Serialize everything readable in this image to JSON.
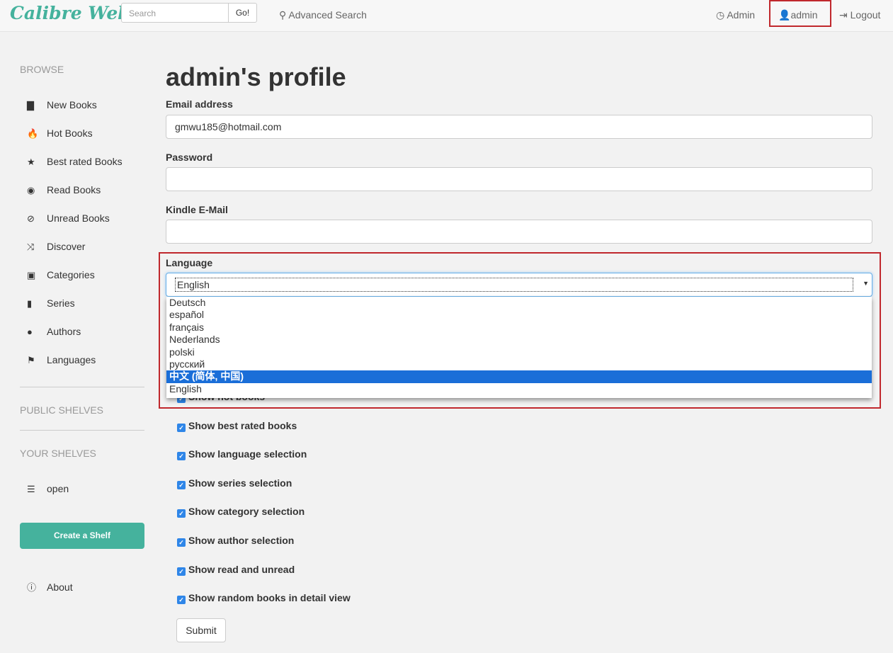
{
  "nav": {
    "logo": "Calibre Web",
    "search_placeholder": "Search",
    "go": "Go!",
    "advanced_search": "Advanced Search",
    "admin": "Admin",
    "user": "admin",
    "logout": "Logout"
  },
  "sidebar": {
    "browse": "BROWSE",
    "items": [
      {
        "icon": "book-icon",
        "glyph": "▇",
        "label": "New Books"
      },
      {
        "icon": "fire-icon",
        "glyph": "🔥",
        "label": "Hot Books"
      },
      {
        "icon": "star-icon",
        "glyph": "★",
        "label": "Best rated Books"
      },
      {
        "icon": "eye-icon",
        "glyph": "◉",
        "label": "Read Books"
      },
      {
        "icon": "eye-slash-icon",
        "glyph": "⊘",
        "label": "Unread Books"
      },
      {
        "icon": "random-icon",
        "glyph": "⤨",
        "label": "Discover"
      },
      {
        "icon": "inbox-icon",
        "glyph": "▣",
        "label": "Categories"
      },
      {
        "icon": "bookmark-icon",
        "glyph": "▮",
        "label": "Series"
      },
      {
        "icon": "user-icon",
        "glyph": "●",
        "label": "Authors"
      },
      {
        "icon": "flag-icon",
        "glyph": "⚑",
        "label": "Languages"
      }
    ],
    "public_shelves": "PUBLIC SHELVES",
    "your_shelves": "YOUR SHELVES",
    "shelf": "open",
    "create_shelf": "Create a Shelf",
    "about": "About"
  },
  "main": {
    "title": "admin's profile",
    "email_label": "Email address",
    "email": "gmwu185@hotmail.com",
    "password_label": "Password",
    "password": "",
    "kindle_label": "Kindle E-Mail",
    "kindle": "",
    "language_label": "Language",
    "language": "English",
    "language_options": [
      "Deutsch",
      "español",
      "français",
      "Nederlands",
      "polski",
      "русский",
      "中文 (简体, 中国)",
      "English"
    ],
    "highlighted_option": "中文 (简体, 中国)",
    "checkboxes": [
      {
        "label": "Show hot books",
        "checked": true
      },
      {
        "label": "Show best rated books",
        "checked": true
      },
      {
        "label": "Show language selection",
        "checked": true
      },
      {
        "label": "Show series selection",
        "checked": true
      },
      {
        "label": "Show category selection",
        "checked": true
      },
      {
        "label": "Show author selection",
        "checked": true
      },
      {
        "label": "Show read and unread",
        "checked": true
      },
      {
        "label": "Show random books in detail view",
        "checked": true
      }
    ],
    "submit": "Submit"
  },
  "colors": {
    "accent": "#45b29d",
    "highlight_box": "#c0282d",
    "selected_option": "#1a6ed8"
  }
}
